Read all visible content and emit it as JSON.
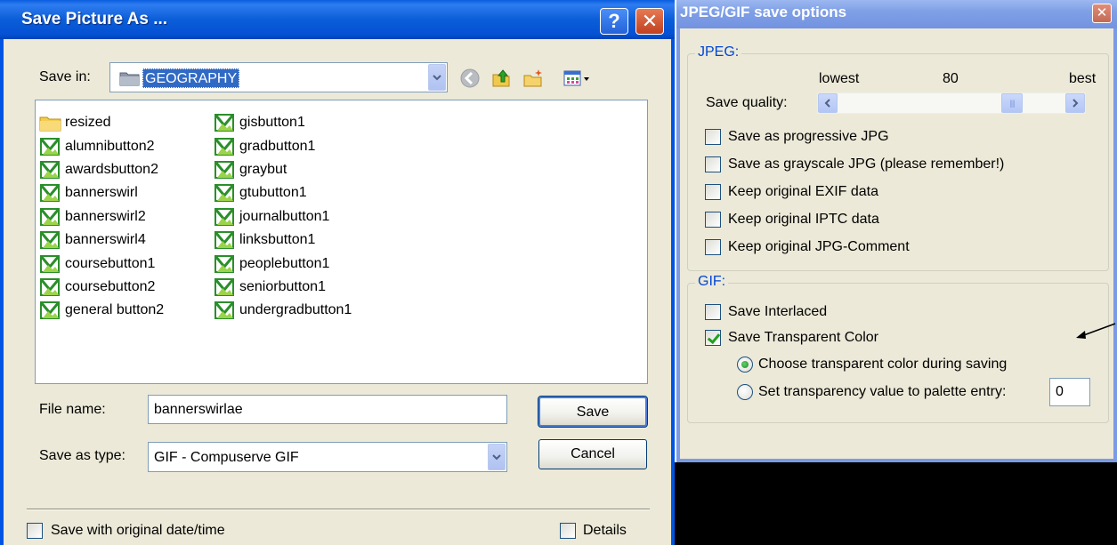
{
  "save_dialog": {
    "title": "Save Picture As ...",
    "help_glyph": "?",
    "close_glyph": "✕",
    "save_in_label": "Save in:",
    "save_in_value": "GEOGRAPHY",
    "nav_icons": [
      "back-icon",
      "up-folder-icon",
      "new-folder-icon",
      "view-menu-icon"
    ],
    "files_col1": [
      "resized",
      "alumnibutton2",
      "awardsbutton2",
      "bannerswirl",
      "bannerswirl2",
      "bannerswirl4",
      "coursebutton1",
      "coursebutton2",
      "general button2"
    ],
    "files_col2": [
      "gisbutton1",
      "gradbutton1",
      "graybut",
      "gtubutton1",
      "journalbutton1",
      "linksbutton1",
      "peoplebutton1",
      "seniorbutton1",
      "undergradbutton1"
    ],
    "file_name_label": "File name:",
    "file_name_value": "bannerswirlae",
    "save_as_type_label": "Save as type:",
    "save_as_type_value": "GIF - Compuserve GIF",
    "save_button": "Save",
    "cancel_button": "Cancel",
    "keep_date_label": "Save with original date/time",
    "keep_date_checked": false,
    "details_label": "Details",
    "details_checked": false
  },
  "options_dialog": {
    "title": "JPEG/GIF save options",
    "close_glyph": "✕",
    "jpeg_group": {
      "caption": "JPEG:",
      "lowest_label": "lowest",
      "quality_value": "80",
      "best_label": "best",
      "quality_label": "Save quality:",
      "quality_level": 0.8,
      "options": [
        {
          "label": "Save as progressive JPG",
          "checked": false
        },
        {
          "label": "Save as grayscale JPG (please remember!)",
          "checked": false
        },
        {
          "label": "Keep original EXIF data",
          "checked": false
        },
        {
          "label": "Keep original IPTC data",
          "checked": false
        },
        {
          "label": "Keep original JPG-Comment",
          "checked": false
        }
      ]
    },
    "gif_group": {
      "caption": "GIF:",
      "interlaced_label": "Save Interlaced",
      "interlaced_checked": false,
      "transparent_label": "Save Transparent Color",
      "transparent_checked": true,
      "radio_choose_label": "Choose transparent color during saving",
      "radio_choose_selected": true,
      "radio_palette_label": "Set transparency value to palette entry:",
      "radio_palette_selected": false,
      "palette_value": "0"
    }
  },
  "colors": {
    "xp_blue": "#0054e3",
    "dialog_face": "#ece9d8",
    "group_caption": "#0046d5",
    "selection": "#316ac5"
  }
}
